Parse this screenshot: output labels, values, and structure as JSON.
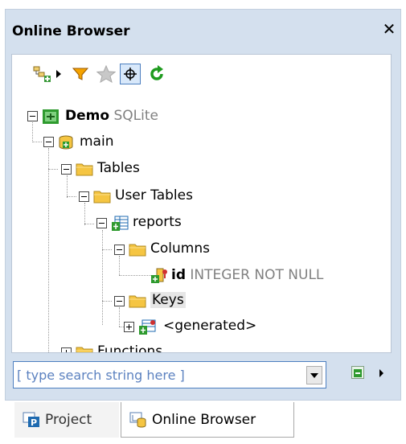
{
  "window": {
    "title": "Online Browser",
    "close_glyph": "✕"
  },
  "toolbar": {
    "icons": [
      "add-datasource-icon",
      "dropdown-arrow-icon",
      "filter-icon",
      "favorite-icon",
      "locate-icon",
      "refresh-icon"
    ]
  },
  "tree": {
    "demo": {
      "label": "Demo",
      "type": "SQLite"
    },
    "main": {
      "label": "main"
    },
    "tables": {
      "label": "Tables"
    },
    "user_tables": {
      "label": "User Tables"
    },
    "reports": {
      "label": "reports"
    },
    "columns": {
      "label": "Columns"
    },
    "id_column": {
      "label": "id",
      "type": "INTEGER NOT NULL"
    },
    "keys": {
      "label": "Keys"
    },
    "generated": {
      "label": "<generated>"
    },
    "functions": {
      "label": "Functions"
    }
  },
  "search": {
    "placeholder": "[ type search string here ]"
  },
  "tabs": [
    {
      "label": "Project"
    },
    {
      "label": "Online Browser"
    }
  ],
  "colors": {
    "panel_bg": "#d4e0ee",
    "folder": "#f5c542",
    "accent_green": "#2e9a2e"
  }
}
